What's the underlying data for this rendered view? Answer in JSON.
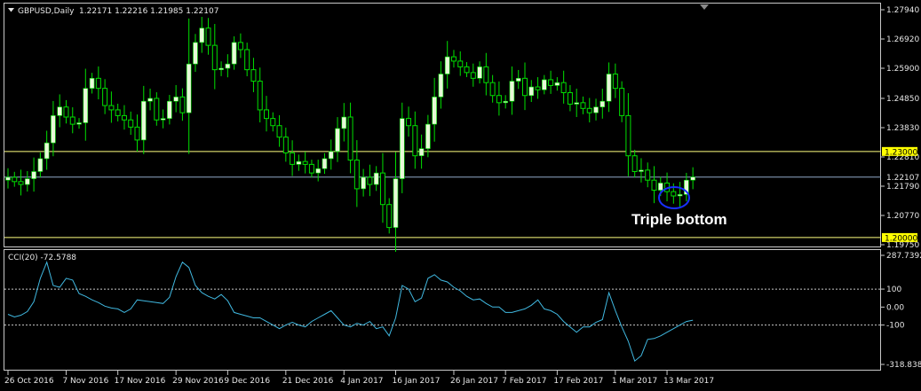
{
  "chart_window": {
    "title": "GBPUSD,Daily",
    "ohlc": "1.22171 1.22216 1.21985 1.22107"
  },
  "colors": {
    "background": "#000000",
    "frame": "#c8c8c8",
    "bull_candle": "#e8f8d8",
    "wick": "#00e000",
    "level_line": "#ffff80",
    "bid_line": "#8fa8c8",
    "cci_line": "#40b8e0",
    "annotation_circle": "#1830ff",
    "level_label_bg": "#ffff00",
    "text": "#e6e6e6"
  },
  "annotation": {
    "text": "Triple bottom"
  },
  "chart_data": [
    {
      "type": "candlestick",
      "title": "GBPUSD,Daily",
      "ylim": [
        1.1975,
        1.2794
      ],
      "y_ticks": [
        "1.27940",
        "1.26920",
        "1.25900",
        "1.24850",
        "1.23830",
        "1.22810",
        "1.21790",
        "1.20770",
        "1.19750"
      ],
      "x_labels": [
        "26 Oct 2016",
        "7 Nov 2016",
        "17 Nov 2016",
        "29 Nov 2016",
        "9 Dec 2016",
        "21 Dec 2016",
        "4 Jan 2017",
        "16 Jan 2017",
        "26 Jan 2017",
        "7 Feb 2017",
        "17 Feb 2017",
        "1 Mar 2017",
        "13 Mar 2017"
      ],
      "horizontal_levels": [
        {
          "value": 1.23,
          "label": "1.23000"
        },
        {
          "value": 1.2,
          "label": "1.20000"
        }
      ],
      "current_price": {
        "value": 1.22107,
        "label": "1.22107"
      },
      "closes": [
        1.221,
        1.2195,
        1.2185,
        1.2205,
        1.223,
        1.2275,
        1.233,
        1.2425,
        1.2455,
        1.242,
        1.2395,
        1.24,
        1.252,
        1.2555,
        1.252,
        1.246,
        1.2445,
        1.2425,
        1.241,
        1.2385,
        1.234,
        1.2475,
        1.2485,
        1.241,
        1.2415,
        1.2475,
        1.249,
        1.2435,
        1.2605,
        1.268,
        1.273,
        1.267,
        1.2585,
        1.259,
        1.2605,
        1.268,
        1.2655,
        1.2585,
        1.2545,
        1.2445,
        1.2415,
        1.239,
        1.235,
        1.2295,
        1.2255,
        1.2265,
        1.2255,
        1.2225,
        1.224,
        1.2275,
        1.23,
        1.238,
        1.242,
        1.227,
        1.217,
        1.221,
        1.2185,
        1.2225,
        1.2115,
        1.2035,
        1.2205,
        1.2415,
        1.239,
        1.2285,
        1.231,
        1.2395,
        1.249,
        1.257,
        1.263,
        1.2615,
        1.2595,
        1.2575,
        1.2555,
        1.2595,
        1.254,
        1.2495,
        1.247,
        1.2475,
        1.2545,
        1.2555,
        1.2495,
        1.2525,
        1.2515,
        1.255,
        1.253,
        1.254,
        1.2505,
        1.2465,
        1.247,
        1.245,
        1.2435,
        1.2455,
        1.2475,
        1.257,
        1.252,
        1.2425,
        1.2285,
        1.223,
        1.2235,
        1.22,
        1.2165,
        1.219,
        1.216,
        1.2145,
        1.215,
        1.22,
        1.2211
      ]
    },
    {
      "type": "line",
      "title": "CCI(20) -72.5788",
      "ylim": [
        -318.8383,
        287.7392
      ],
      "y_ticks": [
        "287.7392",
        "100",
        "0.00",
        "-100",
        "-318.8383"
      ],
      "dotted_levels": [
        100,
        -100
      ],
      "values": [
        -40,
        -55,
        -45,
        -25,
        30,
        160,
        250,
        120,
        110,
        160,
        150,
        75,
        60,
        40,
        25,
        5,
        -5,
        -10,
        -30,
        -10,
        40,
        35,
        30,
        25,
        20,
        55,
        170,
        250,
        220,
        120,
        80,
        60,
        45,
        70,
        35,
        -30,
        -40,
        -50,
        -60,
        -60,
        -80,
        -100,
        -120,
        -100,
        -85,
        -100,
        -110,
        -80,
        -60,
        -40,
        -20,
        -60,
        -100,
        -110,
        -90,
        -100,
        -80,
        -120,
        -110,
        -160,
        -60,
        120,
        100,
        30,
        50,
        160,
        180,
        150,
        140,
        110,
        90,
        60,
        40,
        45,
        20,
        0,
        0,
        -30,
        -30,
        -20,
        -10,
        10,
        40,
        -10,
        -20,
        -40,
        -80,
        -110,
        -140,
        -110,
        -110,
        -85,
        -70,
        80,
        -20,
        -110,
        -190,
        -300,
        -270,
        -180,
        -175,
        -160,
        -140,
        -120,
        -100,
        -80,
        -73
      ]
    }
  ]
}
